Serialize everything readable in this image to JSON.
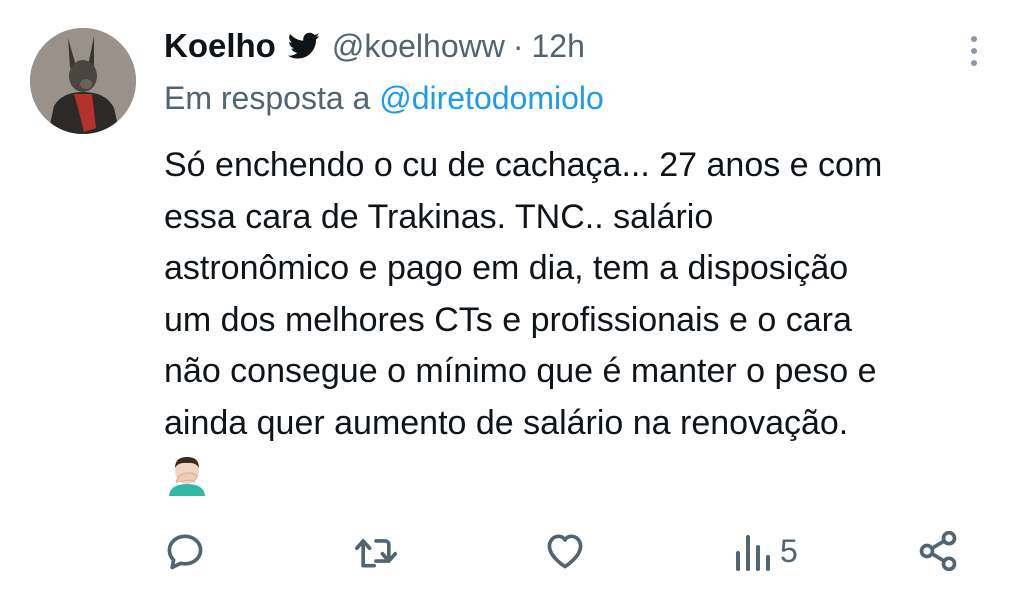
{
  "tweet": {
    "author_name": "Koelho",
    "author_handle": "@koelhoww",
    "separator": "·",
    "time": "12h",
    "reply_prefix": "Em resposta a",
    "reply_mention": "@diretodomiolo",
    "text_lines": [
      "Só enchendo o cu de cachaça... 27 anos e com",
      "essa cara de Trakinas. TNC.. salário",
      "astronômico e pago em dia, tem a disposição",
      "um dos melhores CTs e profissionais e o cara",
      "não consegue o mínimo que é manter o peso e",
      "ainda quer aumento de salário na renovação."
    ],
    "emoji": "man-facepalming-emoji",
    "views": "5"
  },
  "icons": {
    "verified": "twitter-bird-icon",
    "more": "more-vertical-icon",
    "reply": "reply-icon",
    "retweet": "retweet-icon",
    "like": "heart-icon",
    "views": "views-icon",
    "share": "share-icon"
  },
  "colors": {
    "text": "#0f1419",
    "secondary": "#536471",
    "link": "#1d9bf0",
    "icon": "#536471"
  }
}
